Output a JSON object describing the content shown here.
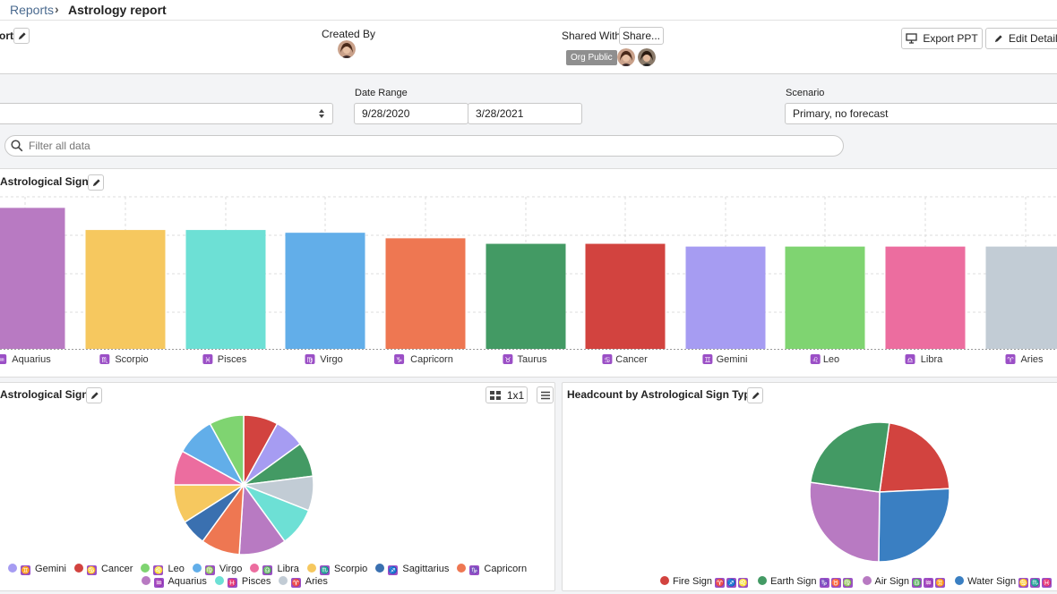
{
  "breadcrumb": {
    "parent": "Reports",
    "separator": "›",
    "current": "Astrology report"
  },
  "header": {
    "title_partial": "ort",
    "created_by_label": "Created By",
    "shared_with_label": "Shared With",
    "share_button": "Share...",
    "org_public_badge": "Org Public",
    "export_button": "Export PPT",
    "edit_details_button": "Edit Details"
  },
  "filters": {
    "date_range_label": "Date Range",
    "date_start": "9/28/2020",
    "date_end": "3/28/2021",
    "scenario_label": "Scenario",
    "scenario_value": "Primary, no forecast",
    "search_placeholder": "Filter all data"
  },
  "bar_panel": {
    "title": "Astrological Sign"
  },
  "pie_panel_left": {
    "title": "Astrological Sign",
    "grid_label": "1x1"
  },
  "pie_panel_right": {
    "title": "Headcount by Astrological Sign Type"
  },
  "chart_data": [
    {
      "type": "bar",
      "title": "Astrological Sign",
      "grid": true,
      "categories": [
        "Aquarius",
        "Scorpio",
        "Pisces",
        "Virgo",
        "Capricorn",
        "Taurus",
        "Cancer",
        "Gemini",
        "Leo",
        "Libra",
        "Aries"
      ],
      "glyphs": [
        "♒",
        "♏",
        "♓",
        "♍",
        "♑",
        "♉",
        "♋",
        "♊",
        "♌",
        "♎",
        "♈"
      ],
      "values": [
        10.2,
        8.6,
        8.6,
        8.4,
        8.0,
        7.6,
        7.6,
        7.4,
        7.4,
        7.4,
        7.4
      ],
      "colors": [
        "#b87ac2",
        "#f6c85f",
        "#6de0d5",
        "#62aee9",
        "#ee7752",
        "#439a64",
        "#d2433f",
        "#a69cf2",
        "#7fd471",
        "#ec6d9f",
        "#c2ccd5"
      ],
      "ylim": [
        0,
        11
      ]
    },
    {
      "type": "pie",
      "title": "Astrological Sign",
      "legend_position": "bottom",
      "slices": [
        {
          "label": "Cancer",
          "glyph": "♋",
          "value": 8,
          "color": "#d2433f"
        },
        {
          "label": "Gemini",
          "glyph": "♊",
          "value": 7,
          "color": "#a69cf2"
        },
        {
          "label": "Taurus",
          "glyph": "♉",
          "value": 8,
          "color": "#439a64"
        },
        {
          "label": "Aries",
          "glyph": "♈",
          "value": 8,
          "color": "#c2ccd5"
        },
        {
          "label": "Pisces",
          "glyph": "♓",
          "value": 9,
          "color": "#6de0d5"
        },
        {
          "label": "Aquarius",
          "glyph": "♒",
          "value": 11,
          "color": "#b87ac2"
        },
        {
          "label": "Capricorn",
          "glyph": "♑",
          "value": 9,
          "color": "#ee7752"
        },
        {
          "label": "Sagittarius",
          "glyph": "♐",
          "value": 6,
          "color": "#3a70b0"
        },
        {
          "label": "Scorpio",
          "glyph": "♏",
          "value": 9,
          "color": "#f6c85f"
        },
        {
          "label": "Libra",
          "glyph": "♎",
          "value": 8,
          "color": "#ec6d9f"
        },
        {
          "label": "Virgo",
          "glyph": "♍",
          "value": 9,
          "color": "#62aee9"
        },
        {
          "label": "Leo",
          "glyph": "♌",
          "value": 8,
          "color": "#7fd471"
        }
      ],
      "legend_rows": [
        [
          "Gemini",
          "Cancer",
          "Leo",
          "Virgo",
          "Libra",
          "Scorpio",
          "Sagittarius",
          "Capricorn"
        ],
        [
          "Aquarius",
          "Pisces",
          "Aries"
        ]
      ]
    },
    {
      "type": "pie",
      "title": "Headcount by Astrological Sign Type",
      "legend_position": "bottom",
      "slices": [
        {
          "label": "Fire Sign",
          "value": 22,
          "color": "#d2433f",
          "glyphs": [
            "♈",
            "♐",
            "♌"
          ]
        },
        {
          "label": "Water Sign",
          "value": 26,
          "color": "#3a7fc2",
          "glyphs": [
            "♋",
            "♏",
            "♓"
          ]
        },
        {
          "label": "Air Sign",
          "value": 27,
          "color": "#b87ac2",
          "glyphs": [
            "♎",
            "♒",
            "♊"
          ]
        },
        {
          "label": "Earth Sign",
          "value": 25,
          "color": "#439a64",
          "glyphs": [
            "♑",
            "♉",
            "♍"
          ]
        }
      ],
      "legend_order": [
        "Fire Sign",
        "Earth Sign",
        "Air Sign",
        "Water Sign"
      ]
    }
  ]
}
